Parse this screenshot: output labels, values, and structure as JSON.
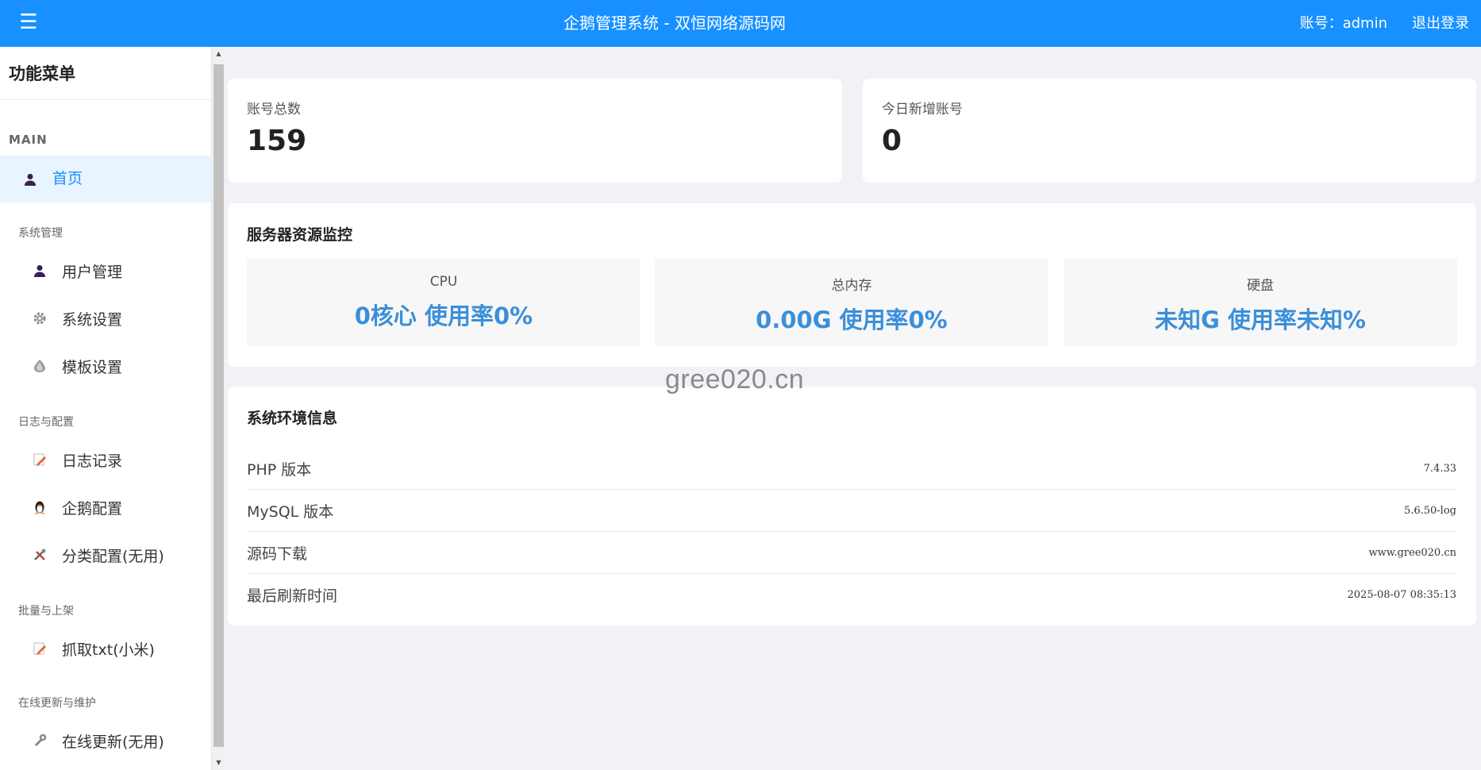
{
  "header": {
    "menu_icon": "☰",
    "title": "企鹅管理系统 - 双恒网络源码网",
    "account": "账号：admin",
    "logout": "退出登录"
  },
  "sidebar": {
    "title": "功能菜单",
    "section": "MAIN",
    "home": "首页",
    "groups": [
      {
        "label": "系统管理",
        "items": [
          "用户管理",
          "系统设置",
          "模板设置"
        ]
      },
      {
        "label": "日志与配置",
        "items": [
          "日志记录",
          "企鹅配置",
          "分类配置(无用)"
        ]
      },
      {
        "label": "批量与上架",
        "items": [
          "抓取txt(小米)"
        ]
      },
      {
        "label": "在线更新与维护",
        "items": [
          "在线更新(无用)"
        ]
      }
    ]
  },
  "stats": [
    {
      "label": "账号总数",
      "value": "159"
    },
    {
      "label": "今日新增账号",
      "value": "0"
    }
  ],
  "monitor": {
    "title": "服务器资源监控",
    "items": [
      {
        "label": "CPU",
        "value": "0核心 使用率0%"
      },
      {
        "label": "总内存",
        "value": "0.00G 使用率0%"
      },
      {
        "label": "硬盘",
        "value": "未知G 使用率未知%"
      }
    ]
  },
  "env": {
    "title": "系统环境信息",
    "rows": [
      {
        "key": "PHP 版本",
        "value": "7.4.33"
      },
      {
        "key": "MySQL 版本",
        "value": "5.6.50-log"
      },
      {
        "key": "源码下载",
        "value": "www.gree020.cn"
      },
      {
        "key": "最后刷新时间",
        "value": "2025-08-07 08:35:13"
      }
    ]
  },
  "watermark": "gree020.cn",
  "colors": {
    "header": "#1890ff",
    "accent": "#3b8fd9",
    "active_bg": "#e8f4ff"
  }
}
